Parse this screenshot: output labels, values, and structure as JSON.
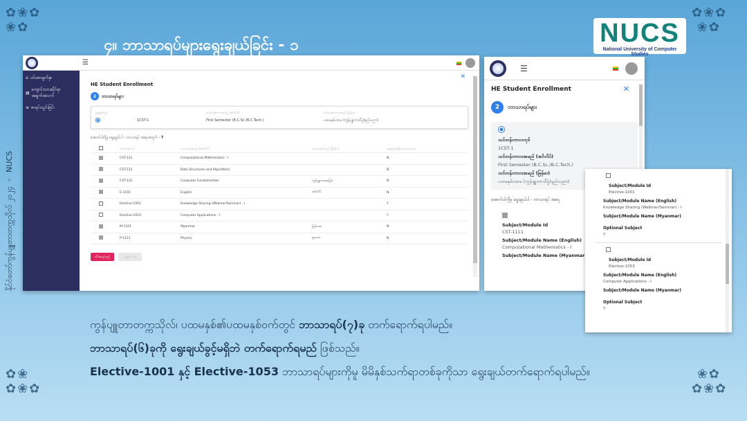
{
  "slide": {
    "title": "၄။ ဘာသာရပ်များရွေးချယ်ခြင်း - ၁",
    "side_caption": "နိုင်ငံတော်ကွန်ပျူတာတက္ကသိုလ် ၂၀၂၄ ◦ NUCS",
    "logo": {
      "big": "NUCS",
      "small": "National University of Computer Studies"
    }
  },
  "desktop": {
    "sidebar": {
      "items": [
        {
          "icon": "home-icon",
          "label": "ပင်မစာမျက်နှာ"
        },
        {
          "icon": "id-card-icon",
          "label": "ကျောင်းသားဆိုင်ရာ အချက်အလက်"
        },
        {
          "icon": "list-icon",
          "label": "စာရင်းသွင်းခြင်း"
        }
      ]
    },
    "page_title": "HE Student Enrollment",
    "step_number": "2",
    "step_label": "ဘာသာရပ်များ",
    "semester_head": [
      "ရွေးချယ်ရန်",
      "သင်တန်းကာလအမည် (အင်္ဂလိပ်)",
      "သင်တန်းကာလအမည် (မြန်မာ)"
    ],
    "semester_row": {
      "code": "1CST-1",
      "name_en": "First Semester (B.C.Sc./B.C.Tech.)",
      "name_mm": "ပထမနှစ်ပထမ (ကွန်ပျူတာသိပ္ပံ/နည်းပညာ)"
    },
    "choose_note": "အောက်ပါတို့မှ ရွေးချယ်ပါ - ဘာသာရပ် အရေအတွက် -",
    "choose_count": "7",
    "table_head": [
      "ဘာသာရပ်ကုဒ်",
      "ဘာသာရပ်အမည် (အင်္ဂလိပ်)",
      "ဘာသာရပ်အမည် (မြန်မာ)",
      "ရွေးချယ်ခွင့်ရှိသောဘာသာရပ်"
    ],
    "rows": [
      {
        "checked": true,
        "code": "CST-111",
        "name_en": "Computational Mathematics - I",
        "name_mm": "",
        "optional": "N"
      },
      {
        "checked": true,
        "code": "CST-121",
        "name_en": "Data Structures and Algorithms",
        "name_mm": "",
        "optional": "N"
      },
      {
        "checked": true,
        "code": "CST-131",
        "name_en": "Computer Fundamentals",
        "name_mm": "ကွန်ပျူတာအခြေခံ",
        "optional": "N"
      },
      {
        "checked": true,
        "code": "E-1101",
        "name_en": "English",
        "name_mm": "အင်္ဂလိပ်",
        "optional": "N"
      },
      {
        "checked": false,
        "code": "Elective-1001",
        "name_en": "Knowledge Sharing (Webinar/Seminar) - I",
        "name_mm": "",
        "optional": "Y"
      },
      {
        "checked": false,
        "code": "Elective-1053",
        "name_en": "Computer Applications - I",
        "name_mm": "",
        "optional": "Y"
      },
      {
        "checked": true,
        "code": "M-1101",
        "name_en": "Myanmar",
        "name_mm": "မြန်မာစာ",
        "optional": "N"
      },
      {
        "checked": true,
        "code": "P-1111",
        "name_en": "Physics",
        "name_mm": "ရူပဗေဒ",
        "optional": "N"
      }
    ],
    "save_label": "သိမ်းဆည်းမည်",
    "next_label": "ရှေ့ဆက်ရန်"
  },
  "mobile": {
    "page_title": "HE Student Enrollment",
    "step_number": "2",
    "step_label": "ဘာသာရပ်များ",
    "fields": [
      {
        "label": "သင်တန်းကာလကုဒ်",
        "value": "1CST-1"
      },
      {
        "label": "သင်တန်းကာလအမည် (အင်္ဂလိပ်)",
        "value": "First Semester (B.C.Sc./B.C.Tech.)"
      },
      {
        "label": "သင်တန်းကာလအမည် (မြန်မာ)",
        "value": "ပထမနှစ်ပထမ (ကွန်ပျူတာသိပ္ပံ/နည်းပညာ)"
      }
    ],
    "choose_note": "အောက်ပါတို့မှ ရွေးချယ်ပါ - ဘာသာရပ် အရေ",
    "subject_id_label": "Subject/Module Id",
    "subject_id_value": "CST-1111",
    "name_en_label": "Subject/Module Name (English)",
    "name_en_value": "Computational Mathematics - I",
    "name_mm_label": "Subject/Module Name (Myanmar)"
  },
  "popup": {
    "items": [
      {
        "id_label": "Subject/Module Id",
        "id_value": "Elective-1001",
        "en_label": "Subject/Module Name (English)",
        "en_value": "Knowledge Sharing (Webinar/Seminar) - I",
        "mm_label": "Subject/Module Name (Myanmar)",
        "opt_label": "Optional Subject",
        "opt_value": "Y"
      },
      {
        "id_label": "Subject/Module Id",
        "id_value": "Elective-1053",
        "en_label": "Subject/Module Name (English)",
        "en_value": "Computer Applications - I",
        "mm_label": "Subject/Module Name (Myanmar)",
        "opt_label": "Optional Subject",
        "opt_value": "Y"
      }
    ]
  },
  "captions": {
    "line1_pre": "ကွန်ပျူတာတက္ကသိုလ်၊ ပထမနှစ်၏ပထမနှစ်ဝက်တွင် ",
    "line1_bold": "ဘာသာရပ်(၇)ခု",
    "line1_post": " တက်ရောက်ရပါမည်။",
    "line2_bold": "ဘာသာရပ်(၆)ခုကို ရွေးချယ်ခွင့်မရှိဘဲ တက်ရောက်ရမည်",
    "line2_post": " ဖြစ်သည်။",
    "line3_bold": "Elective-1001 နှင့် Elective-1053",
    "line3_post": " ဘာသာရပ်များကိုမူ မိမိနှစ်သက်ရာတစ်ခုကိုသာ ရွေးချယ်တက်ရောက်ရပါမည်။"
  },
  "colors": {
    "accent": "#2f80ed",
    "sidebar": "#2b2e5f",
    "save": "#e0245e",
    "logo": "#12837a"
  }
}
